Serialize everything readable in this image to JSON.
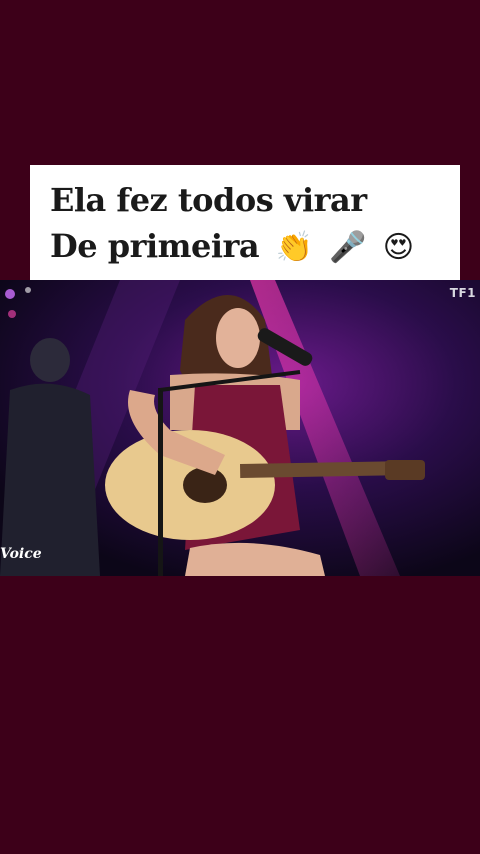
{
  "caption": {
    "line1": "Ela fez todos virar",
    "line2": "De primeira",
    "emojis": [
      "clapping-hands",
      "microphone",
      "heart-eyes-face"
    ]
  },
  "video": {
    "channel_logo": "TF1",
    "show_logo": "Voice"
  },
  "colors": {
    "background": "#3d0019",
    "caption_bg": "#ffffff",
    "caption_text": "#1a1a1a",
    "stage_light": "#c0208a",
    "dress": "#7a1638"
  }
}
